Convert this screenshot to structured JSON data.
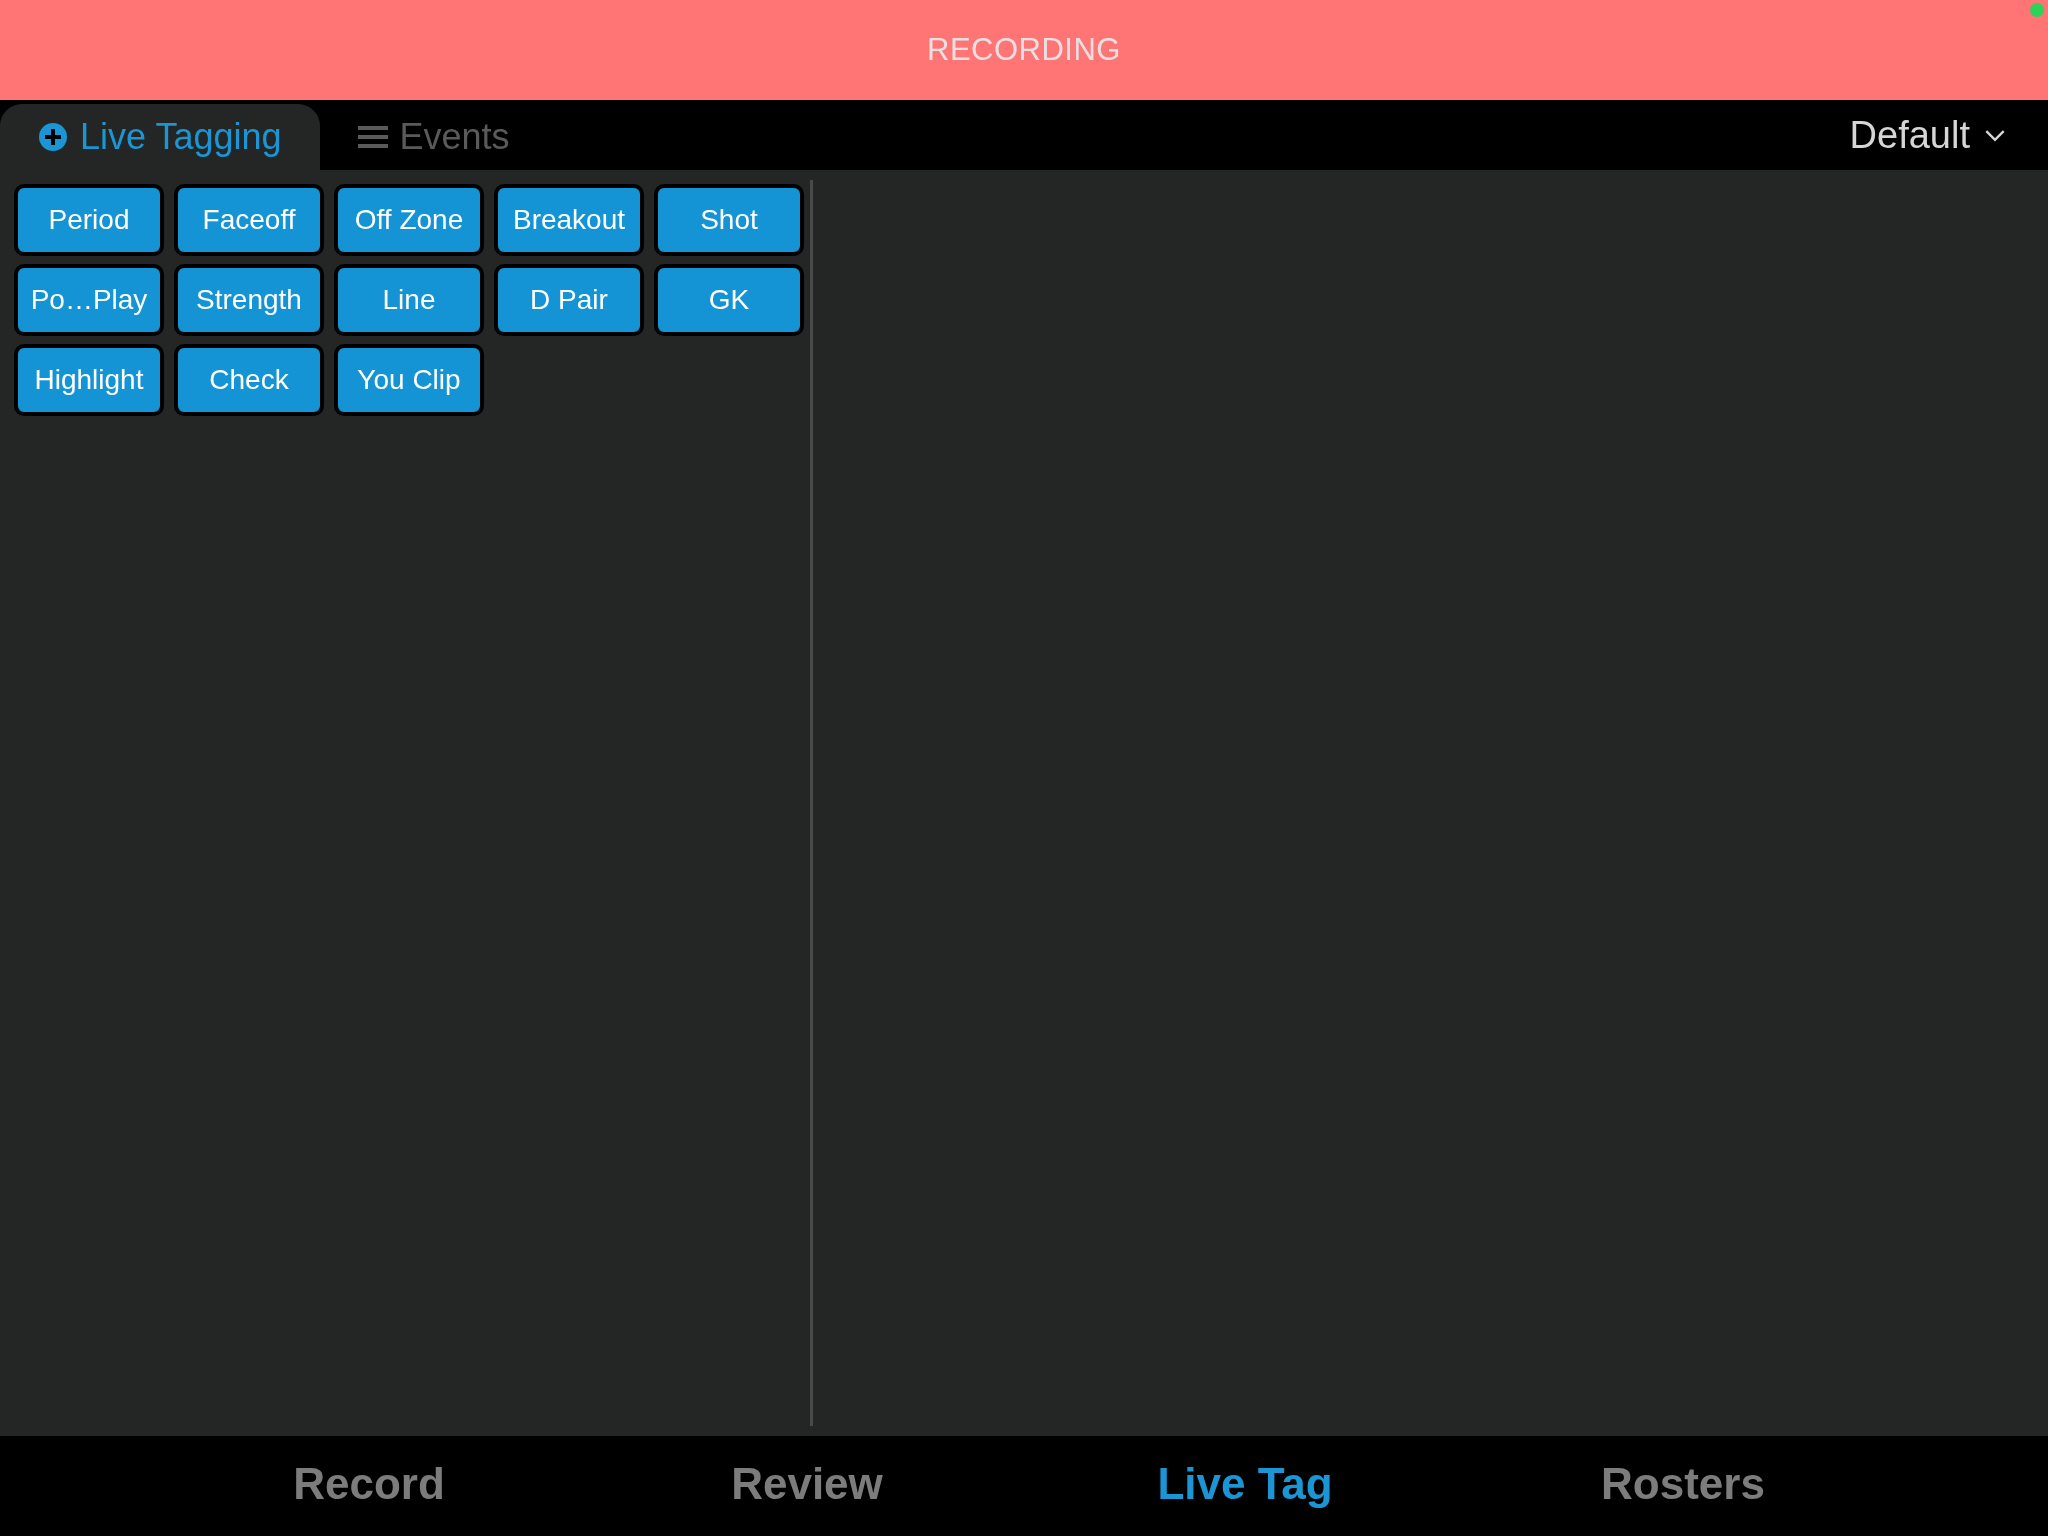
{
  "banner": {
    "title": "RECORDING"
  },
  "tabs": [
    {
      "label": "Live Tagging",
      "kind": "tagging",
      "selected": true
    },
    {
      "label": "Events",
      "kind": "events",
      "selected": false
    }
  ],
  "preset_dropdown": {
    "value": "Default"
  },
  "tag_buttons": [
    "Period",
    "Faceoff",
    "Off Zone",
    "Breakout",
    "Shot",
    "Po…Play",
    "Strength",
    "Line",
    "D Pair",
    "GK",
    "Highlight",
    "Check",
    "You Clip"
  ],
  "bottom_nav": [
    {
      "label": "Record",
      "selected": false
    },
    {
      "label": "Review",
      "selected": false
    },
    {
      "label": "Live Tag",
      "selected": true
    },
    {
      "label": "Rosters",
      "selected": false
    }
  ]
}
